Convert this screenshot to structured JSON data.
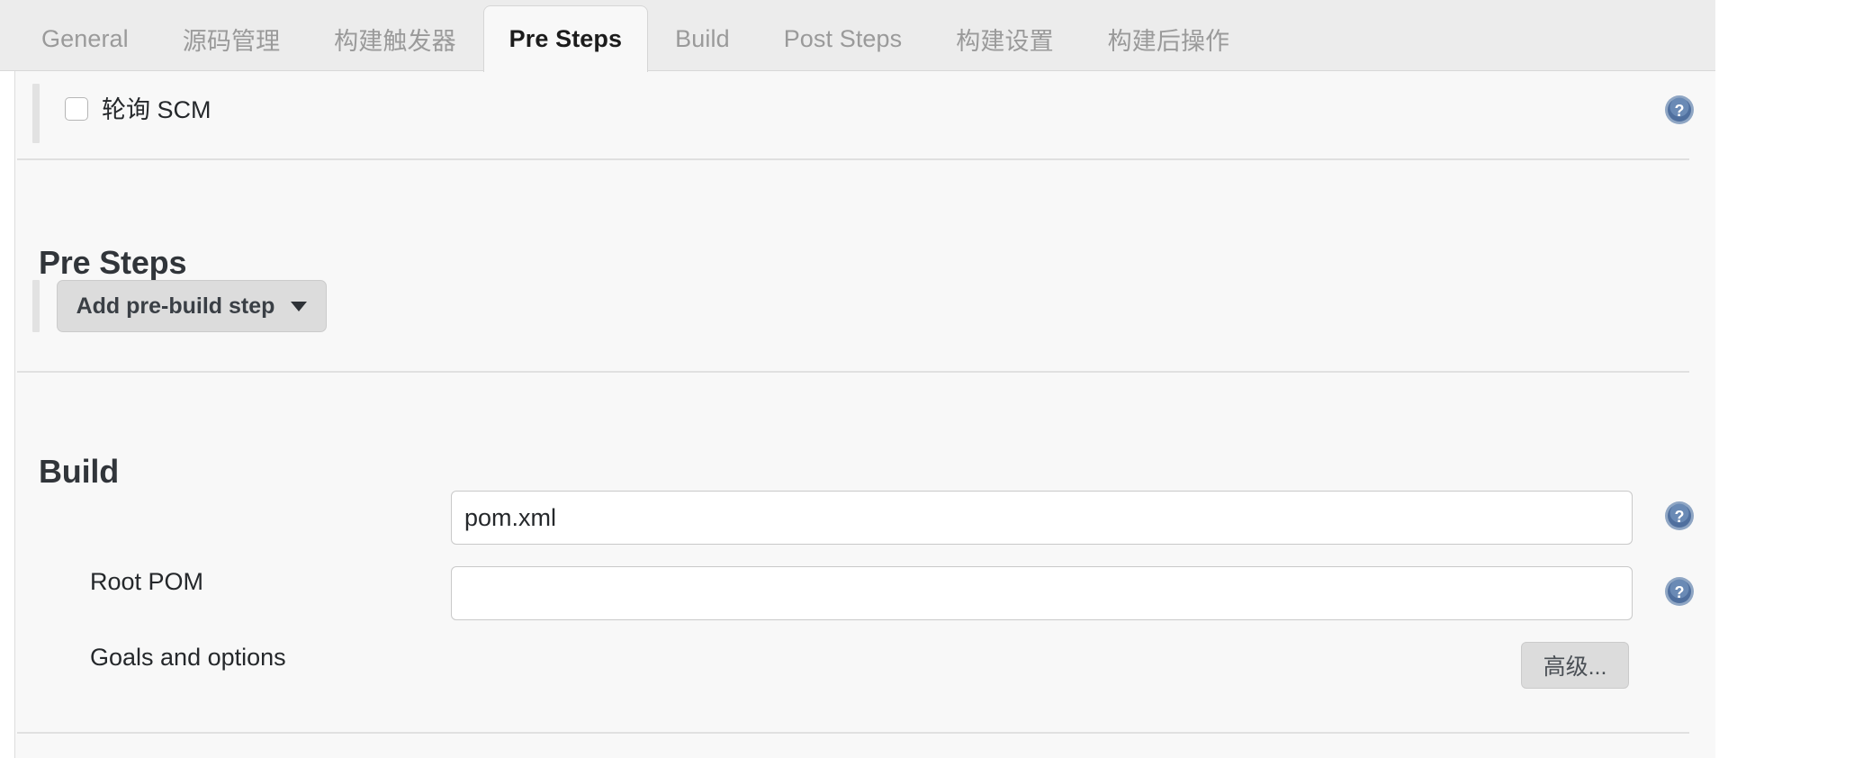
{
  "tabs": [
    {
      "label": "General",
      "active": false
    },
    {
      "label": "源码管理",
      "active": false
    },
    {
      "label": "构建触发器",
      "active": false
    },
    {
      "label": "Pre Steps",
      "active": true
    },
    {
      "label": "Build",
      "active": false
    },
    {
      "label": "Post Steps",
      "active": false
    },
    {
      "label": "构建设置",
      "active": false
    },
    {
      "label": "构建后操作",
      "active": false
    }
  ],
  "scm_trigger": {
    "label": "轮询 SCM",
    "checked": false,
    "help_icon": "help-circle-icon"
  },
  "pre_steps": {
    "heading": "Pre Steps",
    "add_button_label": "Add pre-build step",
    "add_button_icon": "chevron-down-icon"
  },
  "build": {
    "heading": "Build",
    "fields": [
      {
        "label": "Root POM",
        "value": "pom.xml",
        "placeholder": "",
        "help_icon": "help-circle-icon"
      },
      {
        "label": "Goals and options",
        "value": "",
        "placeholder": "",
        "help_icon": "help-circle-icon"
      }
    ],
    "advanced_button_label": "高级..."
  },
  "colors": {
    "tabbar_bg": "#ececec",
    "panel_bg": "#f8f8f8",
    "active_tab_text": "#1c1c1c",
    "inactive_tab_text": "#9a9a9a",
    "button_bg": "#dcdcdc",
    "help_icon_blue": "#5c7cab"
  }
}
